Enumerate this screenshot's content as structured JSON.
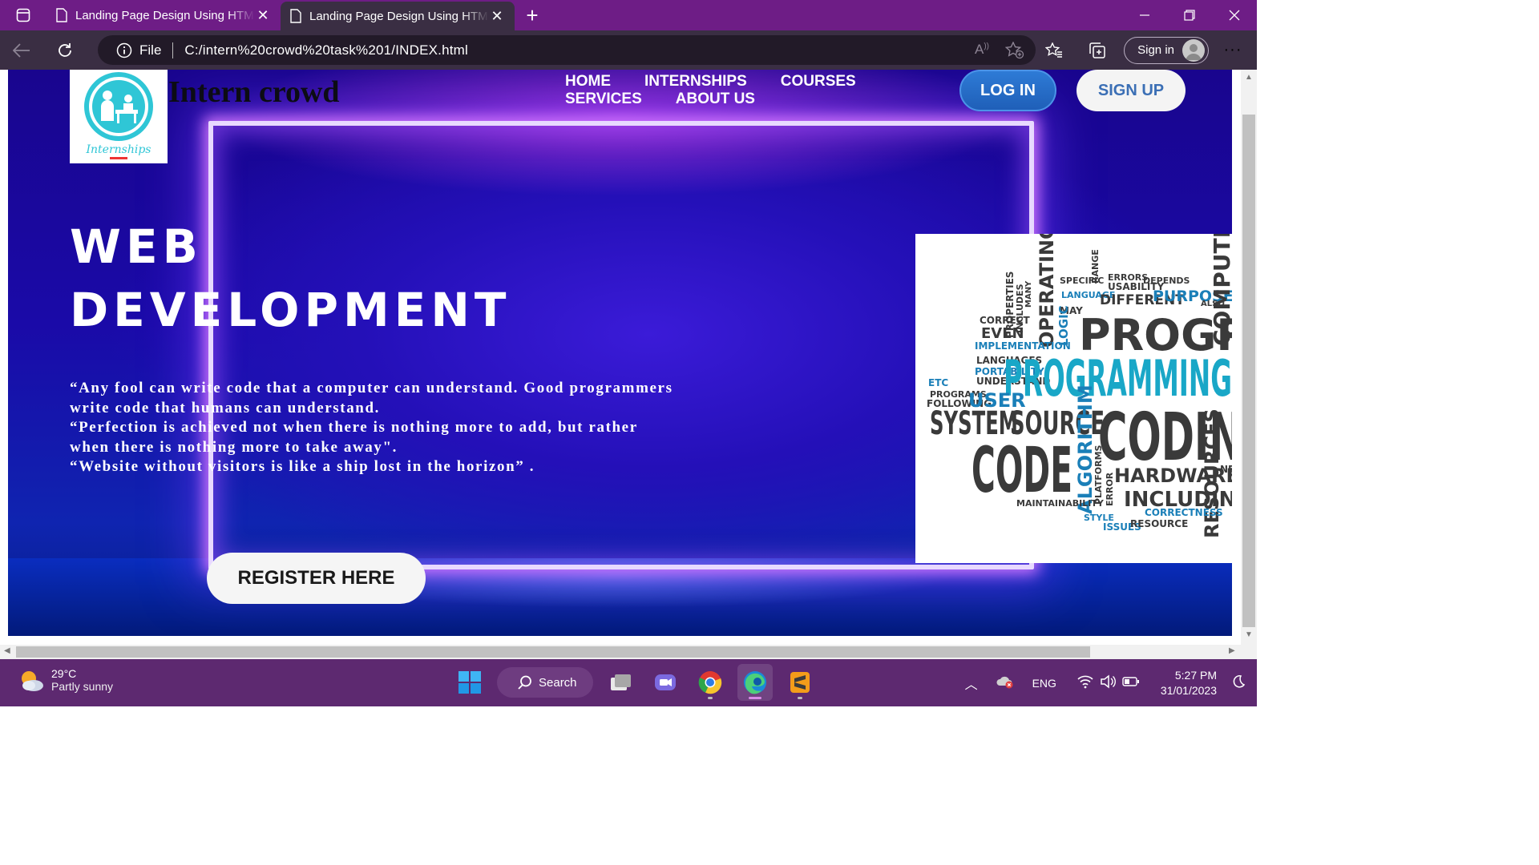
{
  "browser": {
    "tabs": [
      {
        "title": "Landing Page Design Using HTML"
      },
      {
        "title": "Landing Page Design Using HTML"
      }
    ],
    "address": {
      "scheme": "File",
      "url": "C:/intern%20crowd%20task%201/INDEX.html"
    },
    "sign_in": "Sign in"
  },
  "page": {
    "logo_caption": "Internships",
    "brand": "Intern crowd",
    "nav": [
      "HOME",
      "INTERNSHIPS",
      "COURSES",
      "SERVICES",
      "ABOUT US"
    ],
    "login": "LOG IN",
    "signup": "SIGN UP",
    "headline_line1": "WEB",
    "headline_line2": "DEVELOPMENT",
    "quotes": [
      "“Any fool can write code that a computer can understand. Good programmers write code that humans can understand.",
      "“Perfection is achieved not when there is nothing more to add, but rather when there is nothing more to take away\".",
      "“Website without visitors is like a ship lost in the horizon” ."
    ],
    "register": "REGISTER HERE",
    "word_cloud": {
      "words": [
        "SPECIFIC",
        "RANGE",
        "ERRORS",
        "USABILITY",
        "DEPENDS",
        "LANGUAGE",
        "DIFFERENT",
        "PURPOSE",
        "ALSO",
        "COMPUTER",
        "OPERATING",
        "MANY",
        "INCLUDES",
        "PROPERTIES",
        "CORRECT",
        "EVEN",
        "MAY",
        "LOGIC",
        "PROGRAM",
        "IMPLEMENTATION",
        "LANGUAGES",
        "PORTABILITY",
        "UNDERSTAND",
        "PROGRAMMING",
        "ETC",
        "PROGRAMS",
        "FOLLOWING",
        "USER",
        "SYSTEM",
        "SOURCE",
        "CODIN",
        "CODE",
        "ALGORITHM",
        "HARDWARE",
        "NEW",
        "PLATFORMS",
        "ERROR",
        "INCLUDING",
        "RESOURCES",
        "MAINTAINABILITY",
        "CORRECTNESS",
        "STYLE",
        "ISSUES",
        "RESOURCE"
      ]
    }
  },
  "taskbar": {
    "temperature": "29°C",
    "weather": "Partly sunny",
    "search": "Search",
    "language": "ENG",
    "time": "5:27 PM",
    "date": "31/01/2023"
  },
  "colors": {
    "tab_strip": "#6e1d86",
    "toolbar": "#3a2e43",
    "taskbar": "#5d2970",
    "hero_blue": "#1a0aa8",
    "neon": "#d678ff",
    "login_blue": "#2e7bd6",
    "logo_teal": "#2fc6d6"
  }
}
